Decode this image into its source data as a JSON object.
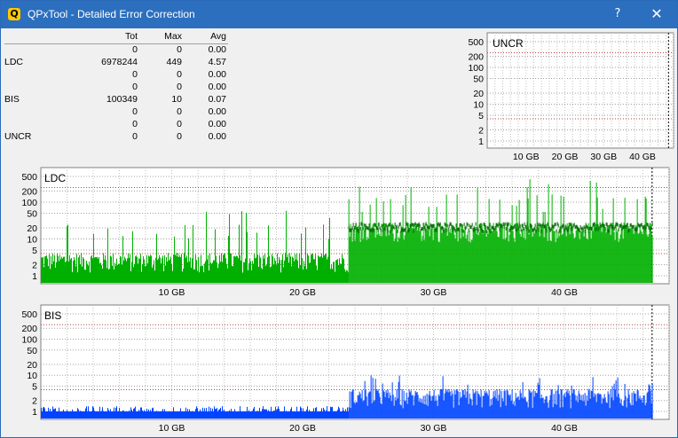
{
  "window": {
    "title": "QPxTool - Detailed Error Correction",
    "help_label": "?",
    "close_label": "✕",
    "titlebar_color": "#2b6fbe"
  },
  "stats": {
    "headers": [
      "",
      "Tot",
      "Max",
      "Avg"
    ],
    "rows": [
      [
        "",
        "0",
        "0",
        "0.00"
      ],
      [
        "LDC",
        "6978244",
        "449",
        "4.57"
      ],
      [
        "",
        "0",
        "0",
        "0.00"
      ],
      [
        "",
        "0",
        "0",
        "0.00"
      ],
      [
        "BIS",
        "100349",
        "10",
        "0.07"
      ],
      [
        "",
        "0",
        "0",
        "0.00"
      ],
      [
        "",
        "0",
        "0",
        "0.00"
      ],
      [
        "UNCR",
        "0",
        "0",
        "0.00"
      ]
    ]
  },
  "chart_data": [
    {
      "type": "bar",
      "title": "UNCR",
      "y_scale": "log",
      "y_ticks": [
        "500",
        "200",
        "100",
        "50",
        "20",
        "10",
        "5",
        "2",
        "1"
      ],
      "x_ticks": [
        "10 GB",
        "20 GB",
        "30 GB",
        "40 GB"
      ],
      "xlim": [
        0,
        48
      ],
      "series": [
        {
          "values": []
        }
      ],
      "color": "#00aa00"
    },
    {
      "type": "bar",
      "title": "LDC",
      "y_scale": "log",
      "y_ticks": [
        "500",
        "200",
        "100",
        "50",
        "20",
        "10",
        "5",
        "2",
        "1"
      ],
      "x_ticks": [
        "10 GB",
        "20 GB",
        "30 GB",
        "40 GB"
      ],
      "xlim": [
        0,
        48
      ],
      "segments": [
        {
          "x_range": [
            0,
            23.5
          ],
          "typical": 3,
          "peaks": [
            10,
            60
          ]
        },
        {
          "x_range": [
            23.5,
            46.7
          ],
          "typical": 20,
          "peaks": [
            50,
            449
          ]
        }
      ],
      "max": 449,
      "color": "#00b000",
      "dark_color": "#006400"
    },
    {
      "type": "bar",
      "title": "BIS",
      "y_scale": "log",
      "y_ticks": [
        "500",
        "200",
        "100",
        "50",
        "20",
        "10",
        "5",
        "2",
        "1"
      ],
      "x_ticks": [
        "10 GB",
        "20 GB",
        "30 GB",
        "40 GB"
      ],
      "xlim": [
        0,
        48
      ],
      "segments": [
        {
          "x_range": [
            0,
            23.5
          ],
          "typical": 1
        },
        {
          "x_range": [
            23.5,
            46.7
          ],
          "typical": 3,
          "peaks": [
            5,
            10
          ]
        }
      ],
      "max": 10,
      "color": "#0044ff"
    }
  ]
}
